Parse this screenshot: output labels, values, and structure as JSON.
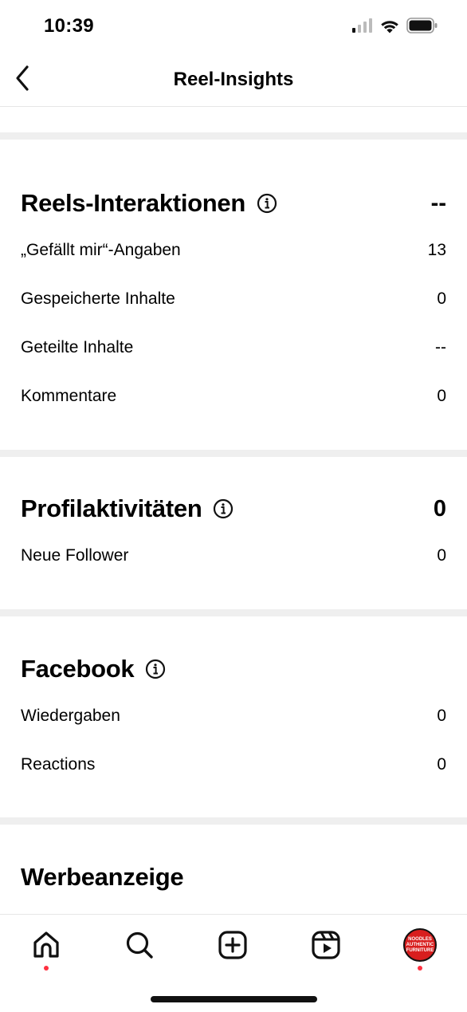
{
  "status_bar": {
    "time": "10:39"
  },
  "header": {
    "title": "Reel-Insights"
  },
  "sections": {
    "reels_interactions": {
      "title": "Reels-Interaktionen",
      "value": "--",
      "rows": [
        {
          "label": "„Gefällt mir“-Angaben",
          "value": "13"
        },
        {
          "label": "Gespeicherte Inhalte",
          "value": "0"
        },
        {
          "label": "Geteilte Inhalte",
          "value": "--"
        },
        {
          "label": "Kommentare",
          "value": "0"
        }
      ]
    },
    "profile_activity": {
      "title": "Profilaktivitäten",
      "value": "0",
      "rows": [
        {
          "label": "Neue Follower",
          "value": "0"
        }
      ]
    },
    "facebook": {
      "title": "Facebook",
      "rows": [
        {
          "label": "Wiedergaben",
          "value": "0"
        },
        {
          "label": "Reactions",
          "value": "0"
        }
      ]
    },
    "ad": {
      "title": "Werbeanzeige"
    }
  },
  "tab_bar": {
    "avatar_text": [
      "NOODLES",
      "AUTHENTIC",
      "FURNITURE"
    ]
  },
  "colors": {
    "notification_dot": "#ff3040",
    "separator": "#efefef",
    "avatar_bg": "#d81e1e"
  }
}
